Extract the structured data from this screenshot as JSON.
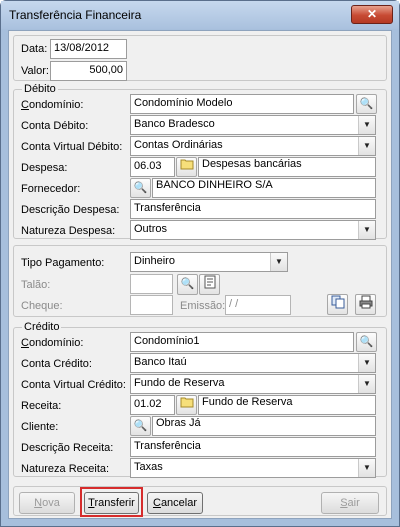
{
  "window": {
    "title": "Transferência Financeira",
    "close": "✕"
  },
  "header": {
    "data_label": "Data:",
    "data_value": "13/08/2012",
    "valor_label": "Valor:",
    "valor_value": "500,00"
  },
  "debito": {
    "group_title": "Débito",
    "condominio_label": "Condomínio:",
    "condominio_value": "Condomínio Modelo",
    "conta_label": "Conta Débito:",
    "conta_value": "Banco Bradesco",
    "conta_virtual_label": "Conta Virtual Débito:",
    "conta_virtual_value": "Contas Ordinárias",
    "despesa_label": "Despesa:",
    "despesa_code": "06.03",
    "despesa_value": "Despesas bancárias",
    "fornecedor_label": "Fornecedor:",
    "fornecedor_value": "BANCO DINHEIRO S/A",
    "descricao_label": "Descrição Despesa:",
    "descricao_value": "Transferência",
    "natureza_label": "Natureza Despesa:",
    "natureza_value": "Outros"
  },
  "pagamento": {
    "tipo_label": "Tipo Pagamento:",
    "tipo_value": "Dinheiro",
    "talao_label": "Talão:",
    "talao_value": "",
    "cheque_label": "Cheque:",
    "cheque_value": "",
    "emissao_label": "Emissão:",
    "emissao_value": "/ /"
  },
  "credito": {
    "group_title": "Crédito",
    "condominio_label": "Condomínio:",
    "condominio_value": "Condomínio1",
    "conta_label": "Conta Crédito:",
    "conta_value": "Banco Itaú",
    "conta_virtual_label": "Conta Virtual Crédito:",
    "conta_virtual_value": "Fundo de Reserva",
    "receita_label": "Receita:",
    "receita_code": "01.02",
    "receita_value": "Fundo de Reserva",
    "cliente_label": "Cliente:",
    "cliente_value": "Obras Já",
    "descricao_label": "Descrição Receita:",
    "descricao_value": "Transferência",
    "natureza_label": "Natureza Receita:",
    "natureza_value": "Taxas"
  },
  "buttons": {
    "nova": "Nova",
    "transferir": "Transferir",
    "cancelar": "Cancelar",
    "sair": "Sair"
  },
  "icons": {
    "binoculars": "binoculars-icon",
    "folder": "folder-icon",
    "form": "form-icon",
    "copy": "copy-icon",
    "print": "printer-icon"
  },
  "colors": {
    "highlight": "#d62c2c",
    "title_bar": "#aac1de",
    "close_button": "#c74a33"
  }
}
